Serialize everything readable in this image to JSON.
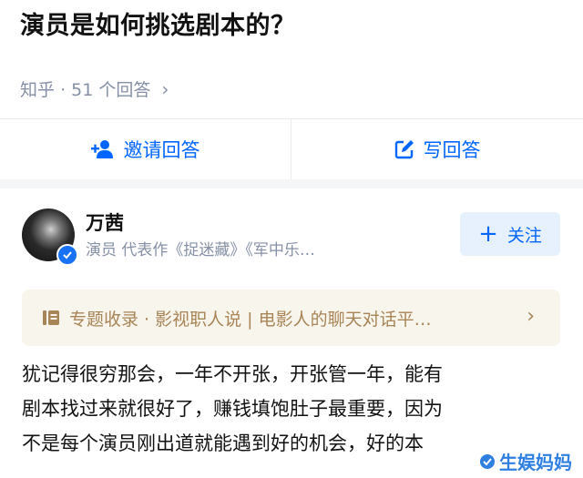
{
  "question": {
    "title": "演员是如何挑选剧本的？",
    "source": "知乎",
    "separator": "·",
    "answer_count": "51 个回答"
  },
  "actions": {
    "invite_label": "邀请回答",
    "write_label": "写回答"
  },
  "answer": {
    "author_name": "万茜",
    "author_bio": "演员 代表作《捉迷藏》《军中乐…",
    "follow_label": "关注",
    "topic_text": "专题收录 · 影视职人说 | 电影人的聊天对话平…",
    "content_lines": [
      "犹记得很穷那会，一年不开张，开张管一年，能有",
      "剧本找过来就很好了，赚钱填饱肚子最重要，因为",
      "不是每个演员刚出道就能遇到好的机会，好的本"
    ]
  },
  "watermark": "生娱妈妈",
  "colors": {
    "accent": "#0066ff",
    "meta_gray": "#8590a6",
    "topic_brown": "#a88456",
    "topic_bg": "#f8f5ec",
    "follow_bg": "#e7f0fd"
  }
}
